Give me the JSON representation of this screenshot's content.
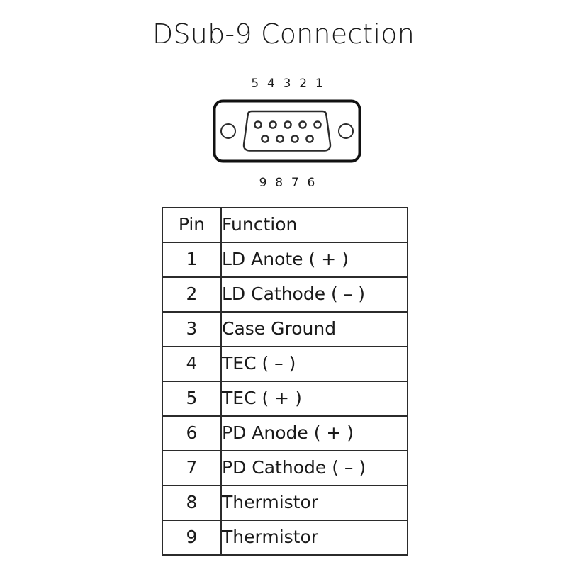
{
  "page": {
    "title": "DSub-9 Connection",
    "background_color": "#ffffff",
    "text_color": "#1a1a1a",
    "line_color": "#2b2b2b"
  },
  "connector": {
    "name": "DSub-9",
    "top_pin_labels": "5 4 3 2 1",
    "bottom_pin_labels": "9 8 7 6",
    "top_row_pin_count": 5,
    "bottom_row_pin_count": 4,
    "mounting_hole_count": 2
  },
  "table": {
    "headers": [
      "Pin",
      "Function"
    ],
    "rows": [
      {
        "pin": "1",
        "function": "LD Anote ( + )"
      },
      {
        "pin": "2",
        "function": "LD Cathode ( – )"
      },
      {
        "pin": "3",
        "function": "Case Ground"
      },
      {
        "pin": "4",
        "function": "TEC ( – )"
      },
      {
        "pin": "5",
        "function": "TEC ( + )"
      },
      {
        "pin": "6",
        "function": "PD Anode ( + )"
      },
      {
        "pin": "7",
        "function": "PD Cathode ( – )"
      },
      {
        "pin": "8",
        "function": "Thermistor"
      },
      {
        "pin": "9",
        "function": "Thermistor"
      }
    ]
  }
}
